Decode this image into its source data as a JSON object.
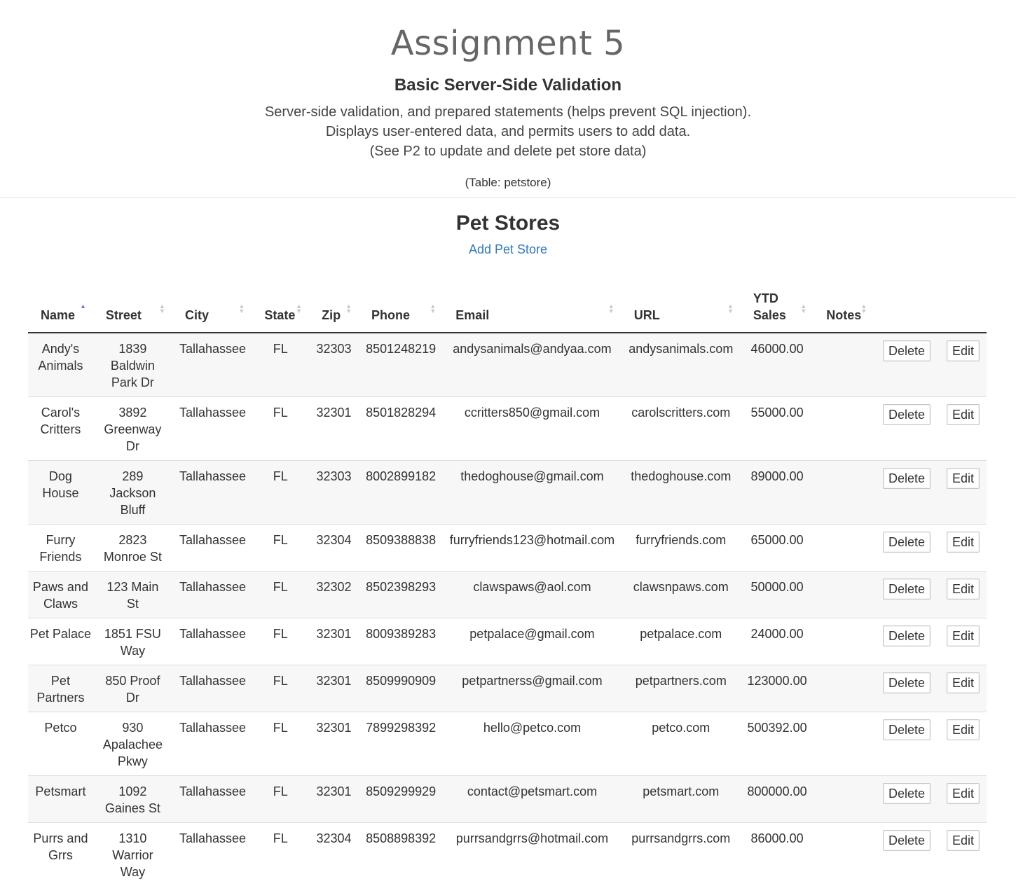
{
  "header": {
    "title": "Assignment 5",
    "subtitle": "Basic Server-Side Validation",
    "description_lines": [
      "Server-side validation, and prepared statements (helps prevent SQL injection).",
      "Displays user-entered data, and permits users to add data.",
      "(See P2 to update and delete pet store data)"
    ],
    "table_note": "(Table: petstore)"
  },
  "section": {
    "title": "Pet Stores",
    "add_link": "Add Pet Store"
  },
  "table": {
    "sorted_column": "Name",
    "sort_direction": "ascending",
    "columns": [
      "Name",
      "Street",
      "City",
      "State",
      "Zip",
      "Phone",
      "Email",
      "URL",
      "YTD Sales",
      "Notes"
    ],
    "delete_label": "Delete",
    "edit_label": "Edit",
    "rows": [
      {
        "name": "Andy's Animals",
        "street": "1839 Baldwin Park Dr",
        "city": "Tallahassee",
        "state": "FL",
        "zip": "32303",
        "phone": "8501248219",
        "email": "andysanimals@andyaa.com",
        "url": "andysanimals.com",
        "ytd_sales": "46000.00",
        "notes": ""
      },
      {
        "name": "Carol's Critters",
        "street": "3892 Greenway Dr",
        "city": "Tallahassee",
        "state": "FL",
        "zip": "32301",
        "phone": "8501828294",
        "email": "ccritters850@gmail.com",
        "url": "carolscritters.com",
        "ytd_sales": "55000.00",
        "notes": ""
      },
      {
        "name": "Dog House",
        "street": "289 Jackson Bluff",
        "city": "Tallahassee",
        "state": "FL",
        "zip": "32303",
        "phone": "8002899182",
        "email": "thedoghouse@gmail.com",
        "url": "thedoghouse.com",
        "ytd_sales": "89000.00",
        "notes": ""
      },
      {
        "name": "Furry Friends",
        "street": "2823 Monroe St",
        "city": "Tallahassee",
        "state": "FL",
        "zip": "32304",
        "phone": "8509388838",
        "email": "furryfriends123@hotmail.com",
        "url": "furryfriends.com",
        "ytd_sales": "65000.00",
        "notes": ""
      },
      {
        "name": "Paws and Claws",
        "street": "123 Main St",
        "city": "Tallahassee",
        "state": "FL",
        "zip": "32302",
        "phone": "8502398293",
        "email": "clawspaws@aol.com",
        "url": "clawsnpaws.com",
        "ytd_sales": "50000.00",
        "notes": ""
      },
      {
        "name": "Pet Palace",
        "street": "1851 FSU Way",
        "city": "Tallahassee",
        "state": "FL",
        "zip": "32301",
        "phone": "8009389283",
        "email": "petpalace@gmail.com",
        "url": "petpalace.com",
        "ytd_sales": "24000.00",
        "notes": ""
      },
      {
        "name": "Pet Partners",
        "street": "850 Proof Dr",
        "city": "Tallahassee",
        "state": "FL",
        "zip": "32301",
        "phone": "8509990909",
        "email": "petpartnerss@gmail.com",
        "url": "petpartners.com",
        "ytd_sales": "123000.00",
        "notes": ""
      },
      {
        "name": "Petco",
        "street": "930 Apalachee Pkwy",
        "city": "Tallahassee",
        "state": "FL",
        "zip": "32301",
        "phone": "7899298392",
        "email": "hello@petco.com",
        "url": "petco.com",
        "ytd_sales": "500392.00",
        "notes": ""
      },
      {
        "name": "Petsmart",
        "street": "1092 Gaines St",
        "city": "Tallahassee",
        "state": "FL",
        "zip": "32301",
        "phone": "8509299929",
        "email": "contact@petsmart.com",
        "url": "petsmart.com",
        "ytd_sales": "800000.00",
        "notes": ""
      },
      {
        "name": "Purrs and Grrs",
        "street": "1310 Warrior Way",
        "city": "Tallahassee",
        "state": "FL",
        "zip": "32304",
        "phone": "8508898392",
        "email": "purrsandgrrs@hotmail.com",
        "url": "purrsandgrrs.com",
        "ytd_sales": "86000.00",
        "notes": ""
      }
    ]
  },
  "colors": {
    "link": "#337ab7",
    "title": "#666666",
    "stripe": "#f7f7f7",
    "sort_active": "#6b7fcf"
  }
}
